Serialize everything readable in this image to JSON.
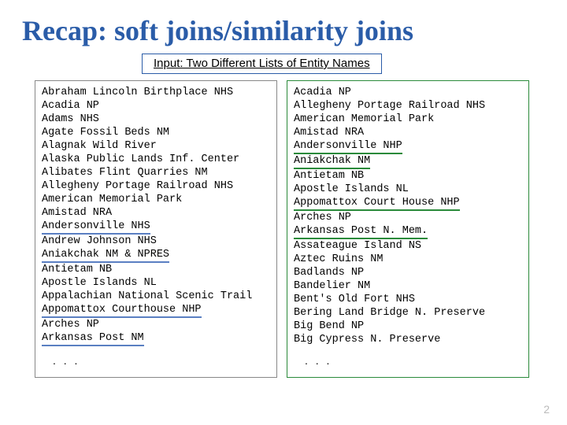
{
  "title": "Recap: soft joins/similarity joins",
  "subtitle": "Input:  Two Different Lists of Entity Names",
  "left_list": [
    {
      "t": "Abraham Lincoln Birthplace NHS",
      "m": ""
    },
    {
      "t": "Acadia NP",
      "m": ""
    },
    {
      "t": "Adams NHS",
      "m": ""
    },
    {
      "t": "Agate Fossil Beds NM",
      "m": ""
    },
    {
      "t": "Alagnak Wild River",
      "m": ""
    },
    {
      "t": "Alaska Public Lands Inf. Center",
      "m": ""
    },
    {
      "t": "Alibates Flint Quarries NM",
      "m": ""
    },
    {
      "t": "Allegheny Portage Railroad NHS",
      "m": ""
    },
    {
      "t": "American Memorial Park",
      "m": ""
    },
    {
      "t": "Amistad NRA",
      "m": ""
    },
    {
      "t": "Andersonville NHS",
      "m": "blue"
    },
    {
      "t": "Andrew Johnson NHS",
      "m": ""
    },
    {
      "t": "Aniakchak NM & NPRES",
      "m": "blue"
    },
    {
      "t": "Antietam NB",
      "m": ""
    },
    {
      "t": "Apostle Islands NL",
      "m": ""
    },
    {
      "t": "Appalachian National Scenic Trail",
      "m": ""
    },
    {
      "t": "Appomattox Courthouse NHP",
      "m": "blue"
    },
    {
      "t": "Arches NP",
      "m": ""
    },
    {
      "t": "Arkansas Post NM",
      "m": "blue"
    }
  ],
  "right_list": [
    {
      "t": "Acadia NP",
      "m": ""
    },
    {
      "t": "Allegheny Portage Railroad NHS",
      "m": ""
    },
    {
      "t": "American Memorial Park",
      "m": ""
    },
    {
      "t": "Amistad NRA",
      "m": ""
    },
    {
      "t": "Andersonville NHP",
      "m": "green"
    },
    {
      "t": "Aniakchak NM",
      "m": "green"
    },
    {
      "t": "Antietam NB",
      "m": ""
    },
    {
      "t": "Apostle Islands NL",
      "m": ""
    },
    {
      "t": "Appomattox Court House NHP",
      "m": "green"
    },
    {
      "t": "Arches NP",
      "m": ""
    },
    {
      "t": "Arkansas Post N. Mem.",
      "m": "green"
    },
    {
      "t": "Assateague Island NS",
      "m": ""
    },
    {
      "t": "Aztec Ruins NM",
      "m": ""
    },
    {
      "t": "Badlands NP",
      "m": ""
    },
    {
      "t": "Bandelier NM",
      "m": ""
    },
    {
      "t": "Bent's Old Fort NHS",
      "m": ""
    },
    {
      "t": "Bering Land Bridge N. Preserve",
      "m": ""
    },
    {
      "t": "Big Bend NP",
      "m": ""
    },
    {
      "t": "Big Cypress N. Preserve",
      "m": ""
    }
  ],
  "ellipsis": ". . .",
  "page_number": "2"
}
